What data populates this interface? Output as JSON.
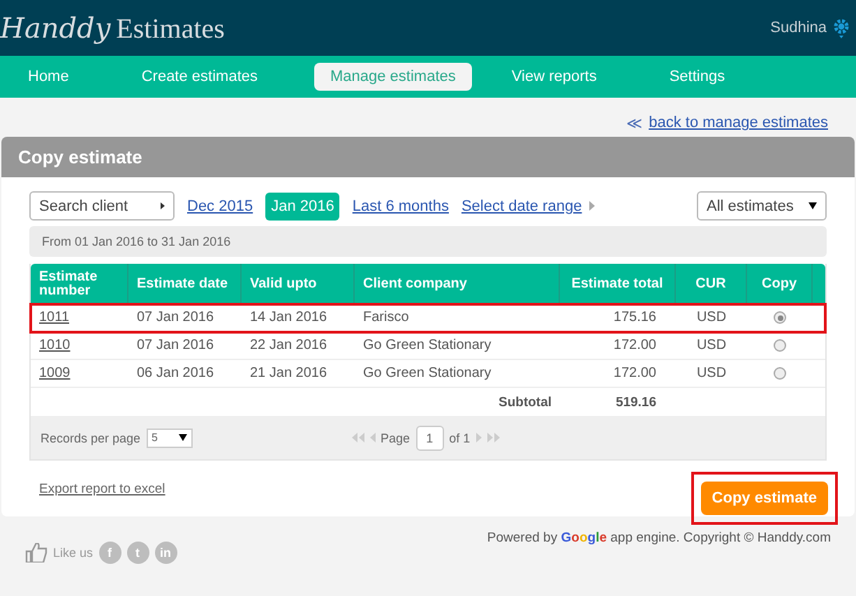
{
  "header": {
    "logo_script": "Handdy",
    "logo_text": "Estimates",
    "user": "Sudhina"
  },
  "nav": [
    {
      "label": "Home",
      "selected": false
    },
    {
      "label": "Create estimates",
      "selected": false
    },
    {
      "label": "Manage estimates",
      "selected": true
    },
    {
      "label": "View reports",
      "selected": false
    },
    {
      "label": "Settings",
      "selected": false
    }
  ],
  "back_link": {
    "arrow": "≪",
    "label": "back to manage estimates"
  },
  "panel": {
    "title": "Copy estimate"
  },
  "filters": {
    "search_client": "Search client",
    "periods": [
      {
        "label": "Dec 2015",
        "selected": false
      },
      {
        "label": "Jan 2016",
        "selected": true
      },
      {
        "label": "Last 6 months",
        "selected": false
      }
    ],
    "date_range": "Select date range",
    "estimate_filter": "All estimates"
  },
  "range_note": "From 01 Jan 2016 to 31 Jan 2016",
  "table": {
    "columns": [
      "Estimate number",
      "Estimate date",
      "Valid upto",
      "Client company",
      "Estimate total",
      "CUR",
      "Copy"
    ],
    "rows": [
      {
        "number": "1011",
        "date": "07 Jan 2016",
        "valid": "14 Jan 2016",
        "client": "Farisco",
        "total": "175.16",
        "cur": "USD",
        "selected": true,
        "highlighted": true
      },
      {
        "number": "1010",
        "date": "07 Jan 2016",
        "valid": "22 Jan 2016",
        "client": "Go Green Stationary",
        "total": "172.00",
        "cur": "USD",
        "selected": false,
        "highlighted": false
      },
      {
        "number": "1009",
        "date": "06 Jan 2016",
        "valid": "21 Jan 2016",
        "client": "Go Green Stationary",
        "total": "172.00",
        "cur": "USD",
        "selected": false,
        "highlighted": false
      }
    ],
    "subtotal_label": "Subtotal",
    "subtotal": "519.16"
  },
  "pager": {
    "records_label": "Records per page",
    "records": "5",
    "page_label": "Page",
    "page": "1",
    "of": "of 1"
  },
  "export_link": "Export report to excel",
  "copy_button": {
    "label": "Copy estimate",
    "highlighted": true
  },
  "footer": {
    "like": "Like us",
    "social": [
      "f",
      "t",
      "in"
    ],
    "powered_prefix": "Powered by",
    "google": "Google",
    "powered_suffix": "app engine. Copyright © Handdy.com"
  }
}
